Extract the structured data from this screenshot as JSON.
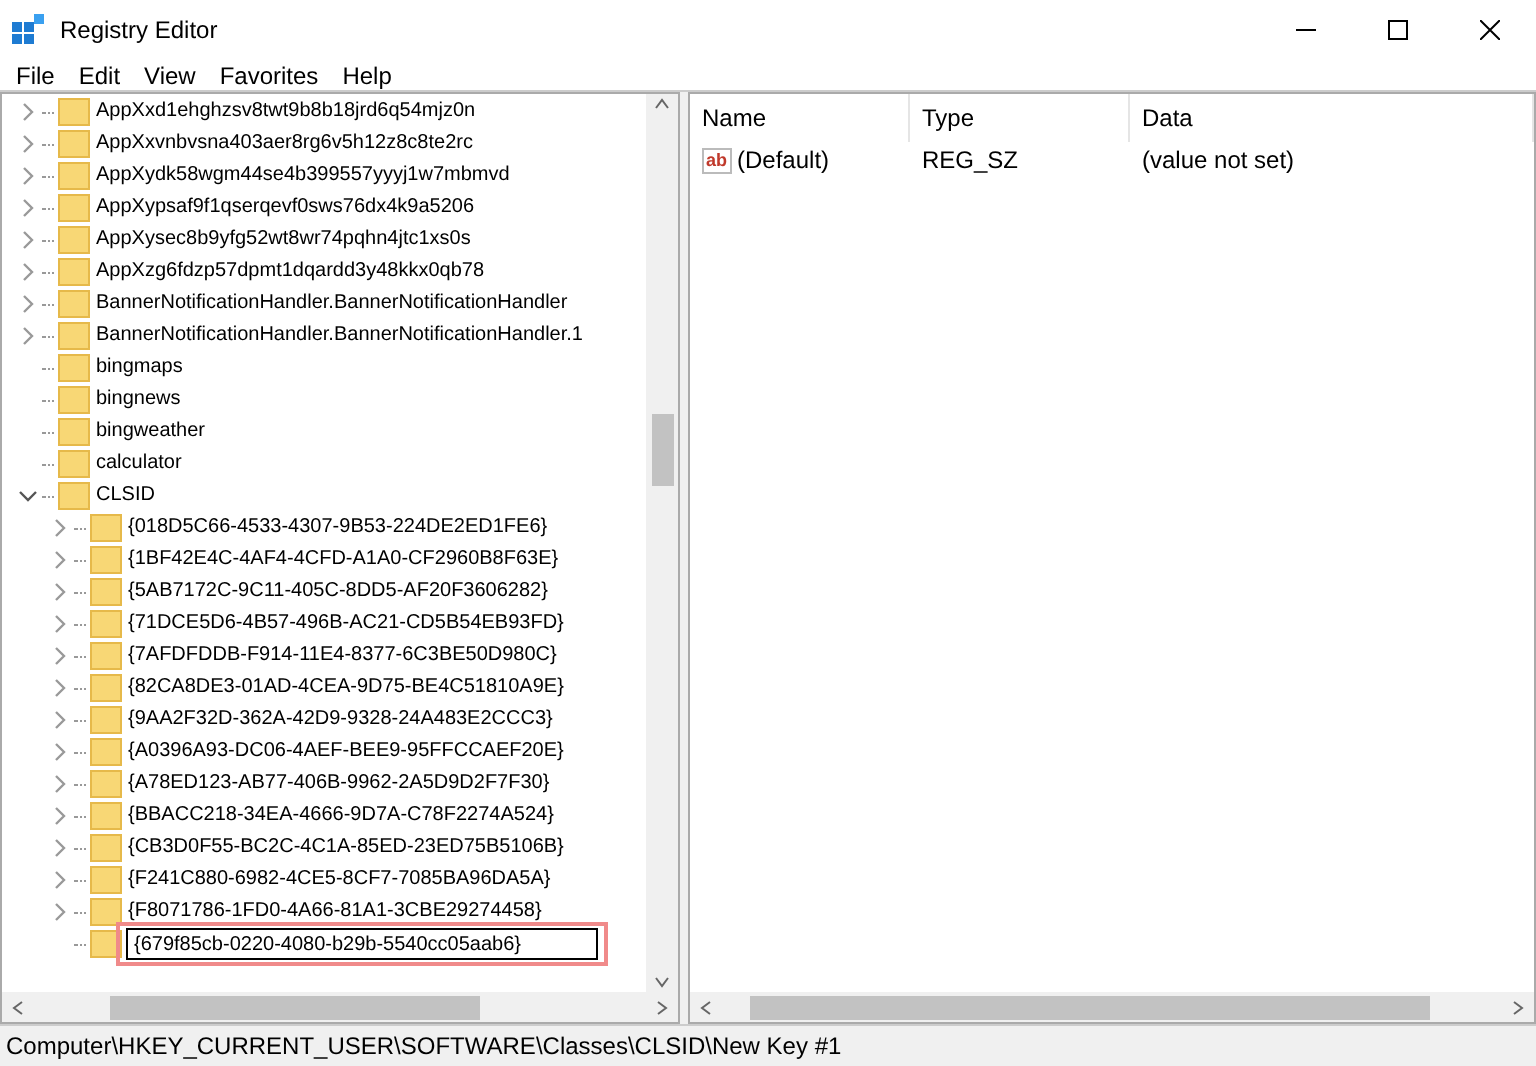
{
  "window": {
    "title": "Registry Editor"
  },
  "menu": [
    "File",
    "Edit",
    "View",
    "Favorites",
    "Help"
  ],
  "tree": [
    {
      "label": "AppXxd1ehghzsv8twt9b8b18jrd6q54mjz0n",
      "expandable": true,
      "expanded": false
    },
    {
      "label": "AppXxvnbvsna403aer8rg6v5h12z8c8te2rc",
      "expandable": true,
      "expanded": false
    },
    {
      "label": "AppXydk58wgm44se4b399557yyyj1w7mbmvd",
      "expandable": true,
      "expanded": false
    },
    {
      "label": "AppXypsaf9f1qserqevf0sws76dx4k9a5206",
      "expandable": true,
      "expanded": false
    },
    {
      "label": "AppXysec8b9yfg52wt8wr74pqhn4jtc1xs0s",
      "expandable": true,
      "expanded": false
    },
    {
      "label": "AppXzg6fdzp57dpmt1dqardd3y48kkx0qb78",
      "expandable": true,
      "expanded": false
    },
    {
      "label": "BannerNotificationHandler.BannerNotificationHandler",
      "expandable": true,
      "expanded": false
    },
    {
      "label": "BannerNotificationHandler.BannerNotificationHandler.1",
      "expandable": true,
      "expanded": false
    },
    {
      "label": "bingmaps",
      "expandable": false
    },
    {
      "label": "bingnews",
      "expandable": false
    },
    {
      "label": "bingweather",
      "expandable": false
    },
    {
      "label": "calculator",
      "expandable": false
    },
    {
      "label": "CLSID",
      "expandable": true,
      "expanded": true,
      "children": [
        {
          "label": "{018D5C66-4533-4307-9B53-224DE2ED1FE6}",
          "expandable": true,
          "expanded": false
        },
        {
          "label": "{1BF42E4C-4AF4-4CFD-A1A0-CF2960B8F63E}",
          "expandable": true,
          "expanded": false
        },
        {
          "label": "{5AB7172C-9C11-405C-8DD5-AF20F3606282}",
          "expandable": true,
          "expanded": false
        },
        {
          "label": "{71DCE5D6-4B57-496B-AC21-CD5B54EB93FD}",
          "expandable": true,
          "expanded": false
        },
        {
          "label": "{7AFDFDDB-F914-11E4-8377-6C3BE50D980C}",
          "expandable": true,
          "expanded": false
        },
        {
          "label": "{82CA8DE3-01AD-4CEA-9D75-BE4C51810A9E}",
          "expandable": true,
          "expanded": false
        },
        {
          "label": "{9AA2F32D-362A-42D9-9328-24A483E2CCC3}",
          "expandable": true,
          "expanded": false
        },
        {
          "label": "{A0396A93-DC06-4AEF-BEE9-95FFCCAEF20E}",
          "expandable": true,
          "expanded": false
        },
        {
          "label": "{A78ED123-AB77-406B-9962-2A5D9D2F7F30}",
          "expandable": true,
          "expanded": false
        },
        {
          "label": "{BBACC218-34EA-4666-9D7A-C78F2274A524}",
          "expandable": true,
          "expanded": false
        },
        {
          "label": "{CB3D0F55-BC2C-4C1A-85ED-23ED75B5106B}",
          "expandable": true,
          "expanded": false
        },
        {
          "label": "{F241C880-6982-4CE5-8CF7-7085BA96DA5A}",
          "expandable": true,
          "expanded": false
        },
        {
          "label": "{F8071786-1FD0-4A66-81A1-3CBE29274458}",
          "expandable": true,
          "expanded": false
        },
        {
          "label": "{679f85cb-0220-4080-b29b-5540cc05aab6}",
          "expandable": false,
          "editing": true
        }
      ]
    }
  ],
  "values": {
    "columns": [
      "Name",
      "Type",
      "Data"
    ],
    "rows": [
      {
        "icon": "ab",
        "name": "(Default)",
        "type": "REG_SZ",
        "data": "(value not set)"
      }
    ]
  },
  "status_bar": "Computer\\HKEY_CURRENT_USER\\SOFTWARE\\Classes\\CLSID\\New Key #1"
}
